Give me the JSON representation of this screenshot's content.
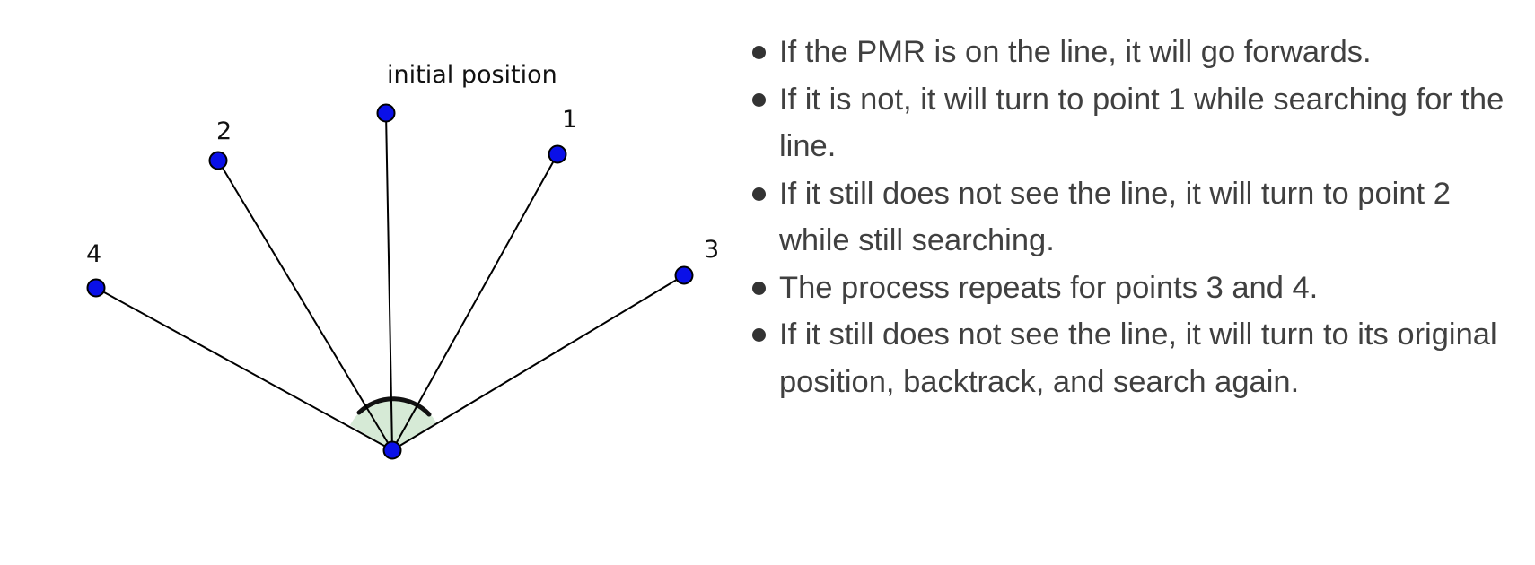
{
  "diagram": {
    "points": [
      {
        "id": "initial",
        "label": "initial position"
      },
      {
        "id": "p1",
        "label": "1"
      },
      {
        "id": "p2",
        "label": "2"
      },
      {
        "id": "p3",
        "label": "3"
      },
      {
        "id": "p4",
        "label": "4"
      }
    ],
    "colors": {
      "point_fill": "#0a10e8",
      "line": "#000000",
      "arc_fill": "#d6ead6"
    }
  },
  "bullets": [
    "If the PMR is on the line, it will go forwards.",
    "If it is not, it will turn to point 1 while searching for the line.",
    "If it still does not see the line, it will turn to point 2 while still searching.",
    "The process repeats for points 3 and 4.",
    "If it still does not see the line, it will turn to its original position, backtrack, and search again."
  ]
}
